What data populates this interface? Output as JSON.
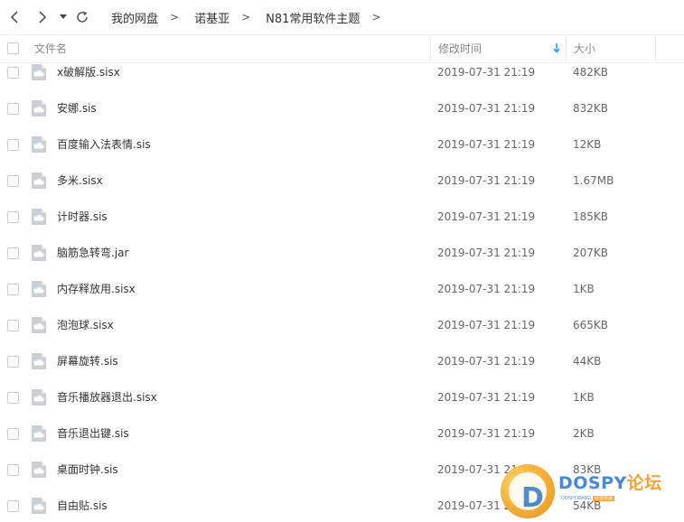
{
  "nav": {
    "back_icon": "chevron-left-icon",
    "forward_icon": "chevron-right-icon",
    "dropdown_icon": "caret-down-icon",
    "refresh_icon": "refresh-icon"
  },
  "breadcrumb": [
    {
      "label": "我的网盘",
      "sep": ">"
    },
    {
      "label": "诺基亚",
      "sep": ">"
    },
    {
      "label": "N81常用软件主题",
      "sep": ">"
    }
  ],
  "columns": {
    "name": "文件名",
    "modified": "修改时间",
    "size": "大小",
    "sort_indicator": "sort-descending-arrow-icon"
  },
  "files": [
    {
      "name": "x破解版.sisx",
      "modified": "2019-07-31 21:19",
      "size": "482KB"
    },
    {
      "name": "安娜.sis",
      "modified": "2019-07-31 21:19",
      "size": "832KB"
    },
    {
      "name": "百度输入法表情.sis",
      "modified": "2019-07-31 21:19",
      "size": "12KB"
    },
    {
      "name": "多米.sisx",
      "modified": "2019-07-31 21:19",
      "size": "1.67MB"
    },
    {
      "name": "计时器.sis",
      "modified": "2019-07-31 21:19",
      "size": "185KB"
    },
    {
      "name": "脑筋急转弯.jar",
      "modified": "2019-07-31 21:19",
      "size": "207KB"
    },
    {
      "name": "内存释放用.sisx",
      "modified": "2019-07-31 21:19",
      "size": "1KB"
    },
    {
      "name": "泡泡球.sisx",
      "modified": "2019-07-31 21:19",
      "size": "665KB"
    },
    {
      "name": "屏幕旋转.sis",
      "modified": "2019-07-31 21:19",
      "size": "44KB"
    },
    {
      "name": "音乐播放器退出.sisx",
      "modified": "2019-07-31 21:19",
      "size": "1KB"
    },
    {
      "name": "音乐退出键.sis",
      "modified": "2019-07-31 21:19",
      "size": "2KB"
    },
    {
      "name": "桌面时钟.sis",
      "modified": "2019-07-31 21:19",
      "size": "83KB"
    },
    {
      "name": "自由贴.sis",
      "modified": "2019-07-31 21:19",
      "size": "54KB"
    }
  ],
  "file_icon": "cloud-file-icon",
  "watermark": {
    "logo_letter": "D",
    "brand": "DOSPY",
    "brand_cn": "论坛",
    "sub_text": "DOSPY.WANG",
    "sub_badge": "原创资源"
  },
  "colors": {
    "file_icon": "#c9d0d8",
    "sort_arrow": "#1e90ff",
    "text": "#333333",
    "muted_text": "#666666",
    "header_text": "#888888",
    "watermark_blue": "#2f7ed8",
    "watermark_orange": "#f39a1e"
  }
}
